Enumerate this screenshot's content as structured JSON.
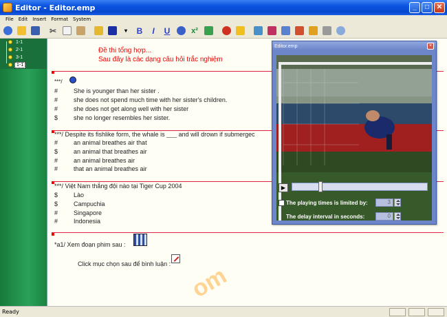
{
  "window": {
    "title": "Editor - Editor.emp"
  },
  "menu": [
    "File",
    "Edit",
    "Insert",
    "Format",
    "System"
  ],
  "toolbar": {
    "icons": [
      "emp-icon",
      "open-icon",
      "save-icon",
      "cut-icon",
      "copy-icon",
      "paste-icon",
      "find-icon",
      "color-icon",
      "dropdown-icon",
      "bold-icon",
      "italic-icon",
      "underline-icon",
      "strike-icon",
      "superscript-icon",
      "table-icon",
      "record-icon",
      "chart-icon",
      "image-icon",
      "bookmark-icon",
      "settings-icon",
      "tools-icon",
      "lock-icon",
      "print-icon",
      "zoom-icon"
    ],
    "bold": "B",
    "italic": "I",
    "underline": "U",
    "superscript": "x²"
  },
  "tree": [
    "1-1",
    "2-1",
    "3-1",
    "1-1"
  ],
  "doc": {
    "title_line1": "Đề thi tổng hợp...",
    "title_line2": "Sau đây là các dạng câu hỏi trắc nghiệm",
    "q1": {
      "prefix": "***/",
      "options": [
        {
          "sym": "#",
          "text": "She is younger than her sister ."
        },
        {
          "sym": "#",
          "text": "she does not spend much time with her sister's children."
        },
        {
          "sym": "#",
          "text": "she does not get along well with her sister"
        },
        {
          "sym": "$",
          "text": "she no longer resembles her sister."
        }
      ]
    },
    "q2": {
      "prefix": "***/ Despite its fishlike form, the whale is ___ and will drown if submergec",
      "options": [
        {
          "sym": "#",
          "text": "an animal breathes air that"
        },
        {
          "sym": "$",
          "text": "an animal that breathes air"
        },
        {
          "sym": "#",
          "text": "an animal breathes air"
        },
        {
          "sym": "#",
          "text": "that an animal breathes air"
        }
      ]
    },
    "q3": {
      "prefix": "***/ Việt Nam thắng đội nào tại Tiger Cup 2004",
      "options": [
        {
          "sym": "$",
          "text": "Lào"
        },
        {
          "sym": "$",
          "text": "Campuchia"
        },
        {
          "sym": "#",
          "text": "Singapore"
        },
        {
          "sym": "#",
          "text": "Indonesia"
        }
      ]
    },
    "q4": {
      "prefix": "*a1/ Xem đoạn phim sau :",
      "comment": "Click mục chọn sau để bình luận :"
    }
  },
  "video_window": {
    "title": "Editor.emp",
    "progress": 0.2,
    "limit_label": "The playing times is limited by:",
    "limit_value": "3",
    "delay_label": "The delay interval in seconds:",
    "delay_value": "0"
  },
  "status": {
    "text": "Ready"
  },
  "watermark": "om",
  "colors": {
    "title_bar": "#0a54e0",
    "tree_panel": "#1f8f48",
    "red_text": "#e00000",
    "video_window": "#6d86c9"
  }
}
